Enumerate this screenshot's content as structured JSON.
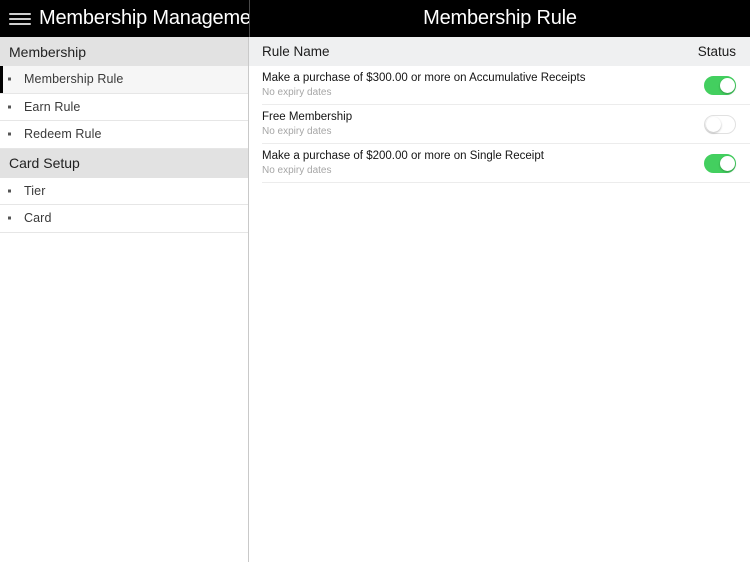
{
  "topbar": {
    "menu_icon": "hamburger-menu-icon",
    "app_title": "Membership Manageme...",
    "page_title": "Membership Rule"
  },
  "sidebar": {
    "sections": [
      {
        "header": "Membership",
        "items": [
          {
            "label": "Membership Rule",
            "selected": true
          },
          {
            "label": "Earn Rule",
            "selected": false
          },
          {
            "label": "Redeem Rule",
            "selected": false
          }
        ]
      },
      {
        "header": "Card Setup",
        "items": [
          {
            "label": "Tier",
            "selected": false
          },
          {
            "label": "Card",
            "selected": false
          }
        ]
      }
    ]
  },
  "content": {
    "columns": {
      "rule_name": "Rule Name",
      "status": "Status"
    },
    "rules": [
      {
        "name": "Make a purchase of $300.00 or more on Accumulative Receipts",
        "expiry": "No expiry dates",
        "enabled": true
      },
      {
        "name": "Free Membership",
        "expiry": "No expiry dates",
        "enabled": false
      },
      {
        "name": "Make a purchase of $200.00 or more on Single Receipt",
        "expiry": "No expiry dates",
        "enabled": true
      }
    ]
  },
  "colors": {
    "toggle_on": "#43cf5f",
    "toggle_off_border": "#e1e1e1",
    "topbar_bg": "#000000",
    "section_header_bg": "#e2e2e2",
    "list_header_bg": "#eff0f1",
    "selection_bar": "#000000"
  }
}
